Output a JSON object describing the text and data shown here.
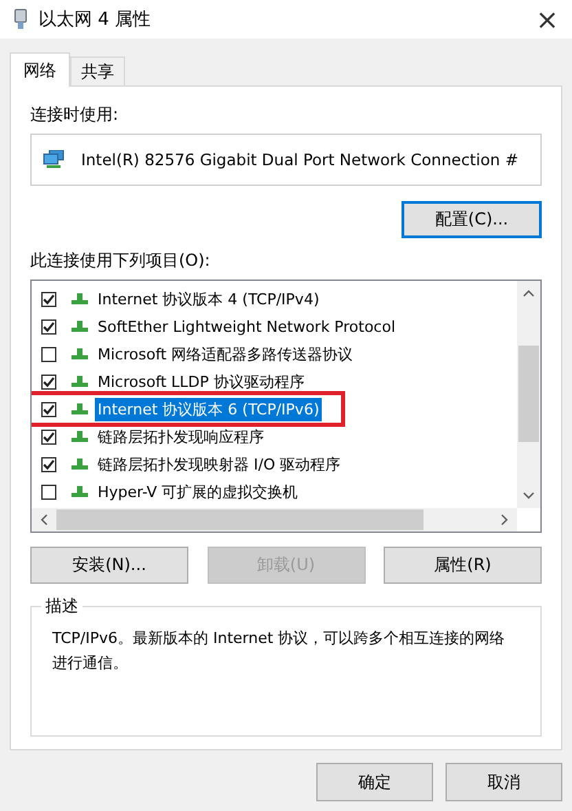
{
  "window": {
    "title": "以太网 4 属性",
    "close": "×"
  },
  "tabs": [
    {
      "label": "网络",
      "selected": true
    },
    {
      "label": "共享",
      "selected": false
    }
  ],
  "connect_using": {
    "label": "连接时使用:",
    "adapter": "Intel(R) 82576 Gigabit Dual Port Network Connection #",
    "configure_button": {
      "label": "配置(C)...",
      "focused": true
    }
  },
  "items_label": "此连接使用下列项目(O):",
  "items": [
    {
      "label": "Internet 协议版本 4 (TCP/IPv4)",
      "checked": true,
      "selected": false,
      "highlighted": false
    },
    {
      "label": "SoftEther Lightweight Network Protocol",
      "checked": true,
      "selected": false,
      "highlighted": false
    },
    {
      "label": "Microsoft 网络适配器多路传送器协议",
      "checked": false,
      "selected": false,
      "highlighted": false
    },
    {
      "label": "Microsoft LLDP 协议驱动程序",
      "checked": true,
      "selected": false,
      "highlighted": false
    },
    {
      "label": "Internet 协议版本 6 (TCP/IPv6)",
      "checked": true,
      "selected": true,
      "highlighted": true
    },
    {
      "label": "链路层拓扑发现响应程序",
      "checked": true,
      "selected": false,
      "highlighted": false
    },
    {
      "label": "链路层拓扑发现映射器 I/O 驱动程序",
      "checked": true,
      "selected": false,
      "highlighted": false
    },
    {
      "label": "Hyper-V 可扩展的虚拟交换机",
      "checked": false,
      "selected": false,
      "highlighted": false
    }
  ],
  "item_buttons": [
    {
      "label": "安装(N)...",
      "disabled": false
    },
    {
      "label": "卸载(U)",
      "disabled": true
    },
    {
      "label": "属性(R)",
      "disabled": false
    }
  ],
  "description": {
    "legend": "描述",
    "text": "TCP/IPv6。最新版本的 Internet 协议，可以跨多个相互连接的网络进行通信。"
  },
  "dialog_buttons": [
    {
      "label": "确定"
    },
    {
      "label": "取消"
    }
  ]
}
